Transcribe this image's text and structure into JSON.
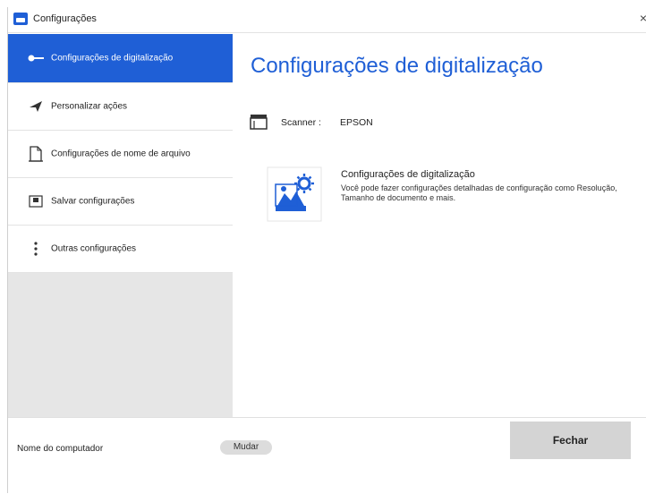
{
  "window": {
    "title": "Configurações",
    "close_glyph": "×",
    "app_icon": "scanner-app-icon"
  },
  "sidebar": {
    "items": [
      {
        "label": "Configurações de digitalização",
        "icon": "scan-settings-icon",
        "active": true
      },
      {
        "label": "Personalizar ações",
        "icon": "send-icon",
        "active": false
      },
      {
        "label": "Configurações de nome de arquivo",
        "icon": "document-icon",
        "active": false
      },
      {
        "label": "Salvar configurações",
        "icon": "save-settings-icon",
        "active": false
      },
      {
        "label": "Outras configurações",
        "icon": "more-vertical-icon",
        "active": false
      }
    ]
  },
  "main": {
    "heading": "Configurações de digitalização",
    "scanner_label": "Scanner :",
    "scanner_value": "EPSON",
    "setting": {
      "title": "Configurações de digitalização",
      "description": "Você pode fazer configurações detalhadas de configuração como Resolução, Tamanho de documento e mais.",
      "icon": "scan-image-gear-icon"
    }
  },
  "footer": {
    "computer_label": "Nome do computador",
    "change_label": "Mudar",
    "close_label": "Fechar"
  },
  "colors": {
    "accent": "#1f5fd6",
    "sidebar_bg": "#e6e6e6",
    "button_bg": "#d4d4d4"
  }
}
